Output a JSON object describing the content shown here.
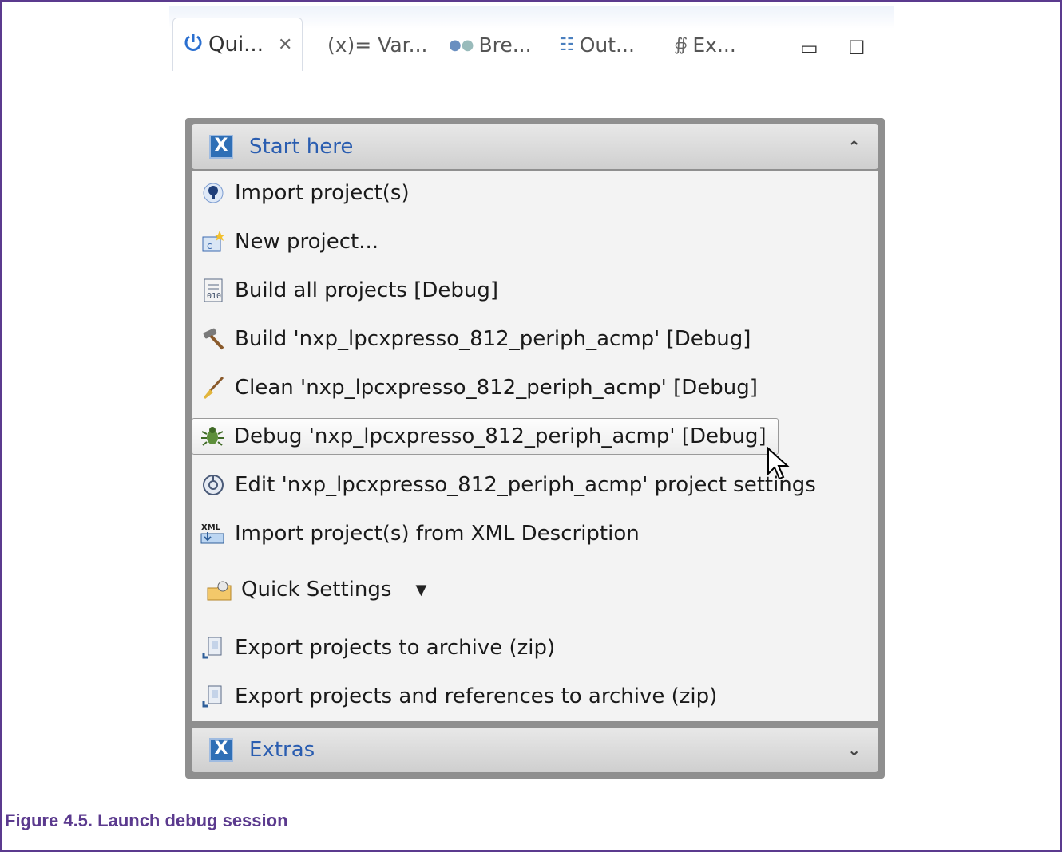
{
  "tabs": [
    {
      "label": "Qui...",
      "icon": "power-icon",
      "active": true
    },
    {
      "label": "(x)= Var...",
      "icon": "variables-icon"
    },
    {
      "label": "Bre...",
      "icon": "breakpoints-icon"
    },
    {
      "label": "Out...",
      "icon": "outline-icon"
    },
    {
      "label": "Ex...",
      "icon": "expressions-icon"
    }
  ],
  "start_section": {
    "title": "Start here",
    "items": [
      {
        "label": "Import project(s)",
        "icon": "import-icon"
      },
      {
        "label": "New project...",
        "icon": "new-project-icon"
      },
      {
        "label": "Build all projects [Debug]",
        "icon": "build-all-icon"
      },
      {
        "label": "Build 'nxp_lpcxpresso_812_periph_acmp' [Debug]",
        "icon": "hammer-icon"
      },
      {
        "label": "Clean 'nxp_lpcxpresso_812_periph_acmp' [Debug]",
        "icon": "broom-icon"
      },
      {
        "label": "Debug 'nxp_lpcxpresso_812_periph_acmp' [Debug]",
        "icon": "bug-icon"
      },
      {
        "label": "Edit 'nxp_lpcxpresso_812_periph_acmp' project settings",
        "icon": "settings-icon"
      },
      {
        "label": "Import project(s) from XML Description",
        "icon": "xml-icon"
      },
      {
        "label": "Quick Settings",
        "icon": "quick-settings-icon"
      },
      {
        "label": "Export projects to archive (zip)",
        "icon": "export-icon"
      },
      {
        "label": "Export projects and references to archive (zip)",
        "icon": "export-icon"
      }
    ]
  },
  "extras_section": {
    "title": "Extras"
  },
  "caption": "Figure 4.5. Launch debug session",
  "colors": {
    "border": "#5b3a8e",
    "section_title": "#2a5db0",
    "caption": "#5b3a8e"
  }
}
